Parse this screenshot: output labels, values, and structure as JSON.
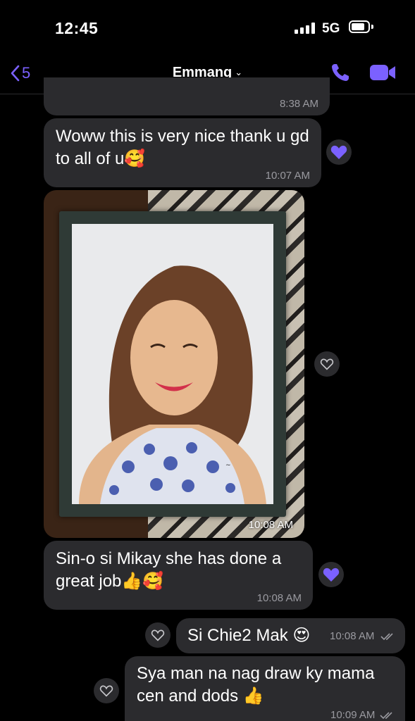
{
  "status_bar": {
    "time": "12:45",
    "network": "5G"
  },
  "header": {
    "back_count": "5",
    "contact_name": "Emmang"
  },
  "messages": [
    {
      "time": "8:38 AM"
    },
    {
      "text": "Woww this is very nice thank u gd to all of u🥰",
      "time": "10:07 AM"
    },
    {
      "time": "10:08 AM"
    },
    {
      "text": "Sin-o si Mikay she has done a great job👍🥰",
      "time": "10:08 AM"
    },
    {
      "text": "Si Chie2 Mak 😍",
      "time": "10:08 AM"
    },
    {
      "text": "Sya man na nag draw ky mama cen and dods 👍",
      "time": "10:09 AM"
    }
  ],
  "colors": {
    "accent": "#7b61ff",
    "bubble": "#2b2b2e",
    "background": "#000000"
  }
}
